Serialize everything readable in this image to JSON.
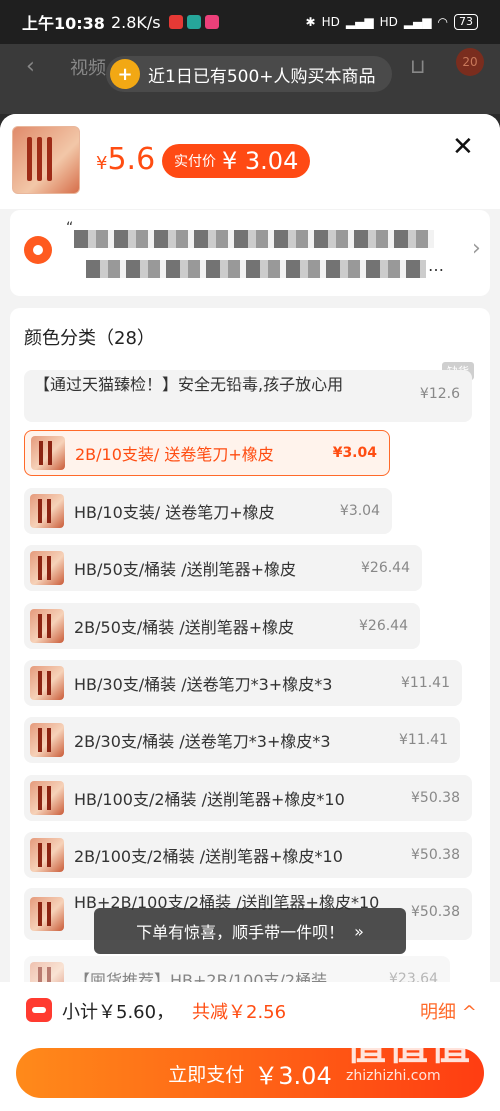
{
  "status_bar": {
    "time": "上午10:38",
    "speed": "2.8K/s",
    "battery": "73",
    "hd1": "HD",
    "hd2": "HD"
  },
  "background_page": {
    "tab_label": "视频",
    "promo_text": "近1日已有500+人购买本商品",
    "badge_count": "20"
  },
  "sku_sheet": {
    "price_symbol": "¥",
    "price": "5.6",
    "real_price_label": "实付价",
    "real_price": "¥ 3.04"
  },
  "address": {
    "masked_line1": "“",
    "masked_line2": "…"
  },
  "variants": {
    "section_title": "颜色分类（28）",
    "stock_tag": "缺货",
    "items": [
      {
        "label": "【通过天猫臻检！】安全无铅毒,孩子放心用",
        "price": "¥12.6"
      },
      {
        "label": "2B/10支装/ 送卷笔刀+橡皮",
        "price": "¥3.04",
        "selected": true
      },
      {
        "label": "HB/10支装/ 送卷笔刀+橡皮",
        "price": "¥3.04"
      },
      {
        "label": "HB/50支/桶装 /送削笔器+橡皮",
        "price": "¥26.44"
      },
      {
        "label": "2B/50支/桶装 /送削笔器+橡皮",
        "price": "¥26.44"
      },
      {
        "label": "HB/30支/桶装 /送卷笔刀*3+橡皮*3",
        "price": "¥11.41"
      },
      {
        "label": "2B/30支/桶装 /送卷笔刀*3+橡皮*3",
        "price": "¥11.41"
      },
      {
        "label": "HB/100支/2桶装 /送削笔器+橡皮*10",
        "price": "¥50.38"
      },
      {
        "label": "2B/100支/2桶装 /送削笔器+橡皮*10",
        "price": "¥50.38"
      },
      {
        "label": "HB+2B/100支/2桶装 /送削笔器+橡皮*10",
        "price": "¥50.38"
      },
      {
        "label": "【囤货推荐】HB+2B/100支/2桶装",
        "price": "¥23.64"
      }
    ]
  },
  "toast": {
    "text": "下单有惊喜，顺手带一件呗！",
    "icon": "double-chevron-down-icon"
  },
  "footer": {
    "subtotal": "小计￥5.60，",
    "discount": "共减￥2.56",
    "detail_label": "明细",
    "pay_label": "立即支付",
    "pay_amount": "￥3.04"
  },
  "watermark": {
    "big": "值值值",
    "url": "zhizhizhi.com"
  },
  "colors": {
    "accent": "#ff4d12",
    "selected_border": "#ff6a2a",
    "background_sheet": "#f3f3f3"
  }
}
